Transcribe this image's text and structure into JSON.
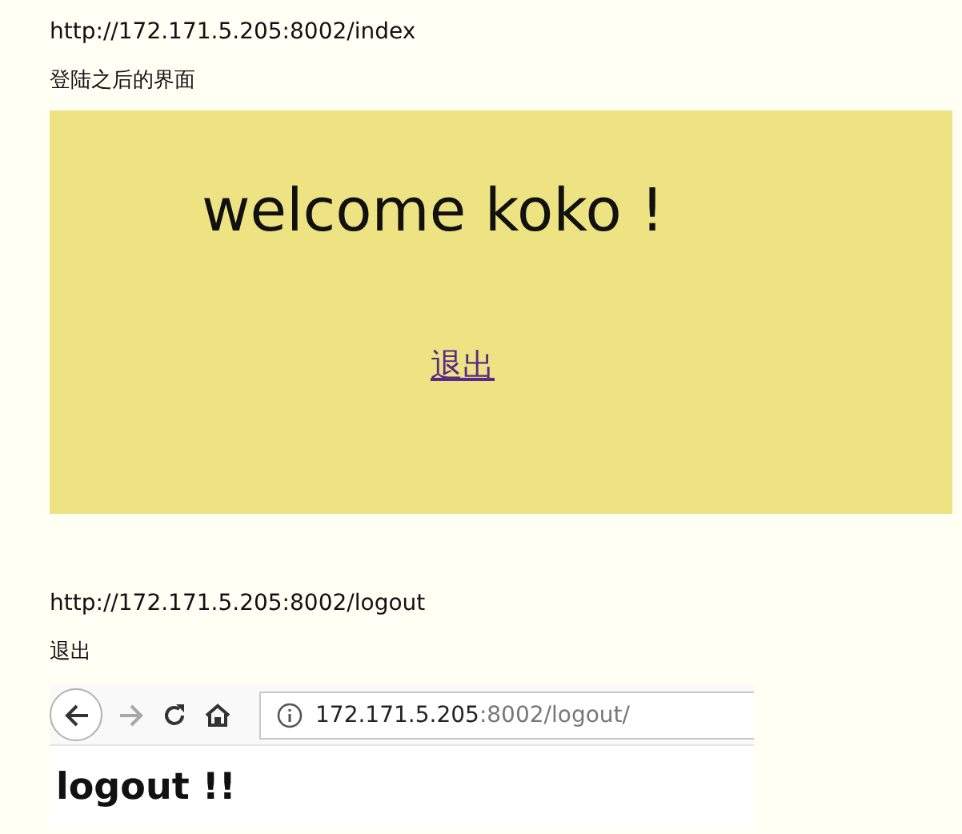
{
  "sections": [
    {
      "url": "http://172.171.5.205:8002/index",
      "caption": "登陆之后的界面",
      "kind": "welcome",
      "welcome": {
        "heading": "welcome koko !",
        "link": "退出",
        "link_visited": true
      }
    },
    {
      "url": "http://172.171.5.205:8002/logout",
      "caption": "退出",
      "kind": "browser",
      "browser": {
        "address_host": "172.171.5.205",
        "address_rest": ":8002/logout/",
        "forward_disabled": true,
        "heading": "logout !!"
      }
    }
  ]
}
